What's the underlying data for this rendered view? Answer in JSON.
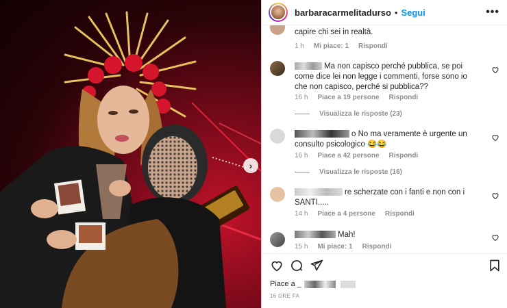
{
  "post": {
    "username": "barbaracarmelitadurso",
    "separator": "•",
    "follow_label": "Segui",
    "more_label": "•••",
    "next_label": "›"
  },
  "comments": [
    {
      "text": "capire chi sei in realtà.",
      "time": "1 h",
      "likes": "Mi piace: 1",
      "reply": "Rispondi"
    },
    {
      "text": "Ma non capisco perché pubblica, se poi come dice lei non legge i commenti, forse sono io che non capisco, perché si pubblica??",
      "time": "16 h",
      "likes": "Piace a 19 persone",
      "reply": "Rispondi",
      "view_replies": "Visualizza le risposte (23)"
    },
    {
      "text": "o No ma veramente è urgente un consulto psicologico 😂😂",
      "time": "16 h",
      "likes": "Piace a 42 persone",
      "reply": "Rispondi",
      "view_replies": "Visualizza le risposte (16)"
    },
    {
      "text": "re scherzate con i fanti e non con i SANTI.....",
      "time": "14 h",
      "likes": "Piace a 4 persone",
      "reply": "Rispondi"
    },
    {
      "text": "Mah!",
      "time": "15 h",
      "likes": "Mi piace: 1",
      "reply": "Rispondi"
    }
  ],
  "footer": {
    "liked_by": "Piace a _",
    "time_ago": "16 ORE FA"
  },
  "icons": [
    "heart-icon",
    "comment-icon",
    "share-icon",
    "bookmark-icon",
    "more-icon",
    "chevron-right-icon"
  ],
  "colors": {
    "link_blue": "#0095f6",
    "secondary_text": "#8e8e8e",
    "primary_text": "#262626"
  }
}
